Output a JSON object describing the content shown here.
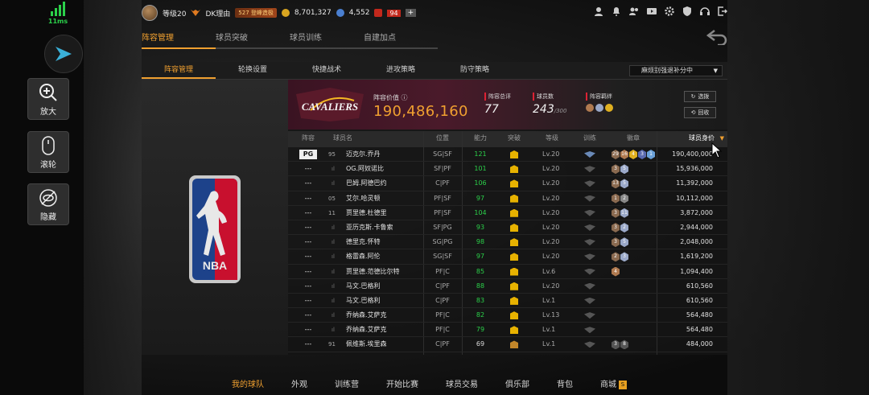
{
  "hud": {
    "ping": "11ms",
    "btn_zoom": "放大",
    "btn_scroll": "滚轮",
    "btn_hide": "隐藏"
  },
  "topbar": {
    "level": "等级20",
    "name": "DK理由",
    "rank": "527 登峰造极",
    "gold": "8,701,327",
    "diamonds": "4,552",
    "tickets": "94",
    "plus": "+"
  },
  "main_tabs": [
    "阵容管理",
    "球员突破",
    "球员训练",
    "自建加点"
  ],
  "sub_tabs": [
    "阵容管理",
    "轮换设置",
    "快捷战术",
    "进攻策略",
    "防守策略"
  ],
  "dropdown": "麻烦别强退补分中",
  "team": {
    "value_label": "阵容价值",
    "value": "190,486,160",
    "rating_label": "阵容总评",
    "rating": "77",
    "count_label": "球员数",
    "count": "243",
    "count_max": "/300",
    "chem_label": "阵容羁绊",
    "btn_select": "选拨",
    "btn_recycle": "回收"
  },
  "columns": [
    "阵容",
    "球员名",
    "位置",
    "能力",
    "突破",
    "等级",
    "训练",
    "徽章",
    "球员身价"
  ],
  "players": [
    {
      "lineup": "PG",
      "num": "95",
      "name": "迈克尔.乔丹",
      "pos": "SG|SF",
      "ability": "121",
      "level": "Lv.20",
      "value": "190,400,000"
    },
    {
      "lineup": "---",
      "num": "",
      "name": "OG.阿奴诺比",
      "pos": "SF|PF",
      "ability": "101",
      "level": "Lv.20",
      "value": "15,936,000"
    },
    {
      "lineup": "---",
      "num": "",
      "name": "巴姆.阿德巴约",
      "pos": "C|PF",
      "ability": "106",
      "level": "Lv.20",
      "value": "11,392,000"
    },
    {
      "lineup": "---",
      "num": "05",
      "name": "艾尔.哈灵顿",
      "pos": "PF|SF",
      "ability": "97",
      "level": "Lv.20",
      "value": "10,112,000"
    },
    {
      "lineup": "---",
      "num": "11",
      "name": "贾里德.杜德里",
      "pos": "PF|SF",
      "ability": "104",
      "level": "Lv.20",
      "value": "3,872,000"
    },
    {
      "lineup": "---",
      "num": "",
      "name": "亚历克斯.卡鲁索",
      "pos": "SF|PG",
      "ability": "93",
      "level": "Lv.20",
      "value": "2,944,000"
    },
    {
      "lineup": "---",
      "num": "",
      "name": "德里克.怀特",
      "pos": "SG|PG",
      "ability": "98",
      "level": "Lv.20",
      "value": "2,048,000"
    },
    {
      "lineup": "---",
      "num": "",
      "name": "格雷森.阿伦",
      "pos": "SG|SF",
      "ability": "97",
      "level": "Lv.20",
      "value": "1,619,200"
    },
    {
      "lineup": "---",
      "num": "",
      "name": "贾里德.范德比尔特",
      "pos": "PF|C",
      "ability": "85",
      "level": "Lv.6",
      "value": "1,094,400"
    },
    {
      "lineup": "---",
      "num": "",
      "name": "马文.巴格利",
      "pos": "C|PF",
      "ability": "88",
      "level": "Lv.20",
      "value": "610,560"
    },
    {
      "lineup": "---",
      "num": "",
      "name": "马文.巴格利",
      "pos": "C|PF",
      "ability": "83",
      "level": "Lv.1",
      "value": "610,560"
    },
    {
      "lineup": "---",
      "num": "",
      "name": "乔纳森.艾萨克",
      "pos": "PF|C",
      "ability": "82",
      "level": "Lv.13",
      "value": "564,480"
    },
    {
      "lineup": "---",
      "num": "",
      "name": "乔纳森.艾萨克",
      "pos": "PF|C",
      "ability": "79",
      "level": "Lv.1",
      "value": "564,480"
    },
    {
      "lineup": "---",
      "num": "91",
      "name": "佩维斯.埃里森",
      "pos": "C|PF",
      "ability": "69",
      "level": "Lv.1",
      "value": "484,000"
    }
  ],
  "bottom_nav": [
    "我的球队",
    "外观",
    "训练营",
    "开始比赛",
    "球员交易",
    "俱乐部",
    "背包",
    "商城"
  ],
  "shop_badge": "S",
  "colors": {
    "accent": "#f0a030",
    "ability_green": "#2bd14a",
    "team_red": "#c2281c"
  }
}
